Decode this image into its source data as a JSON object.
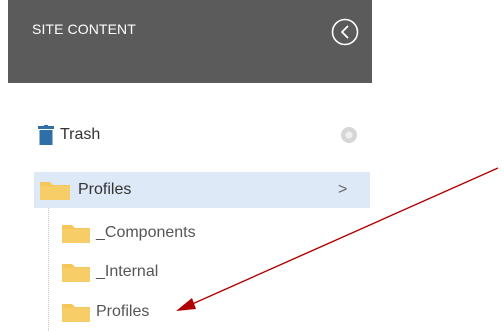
{
  "sidebar": {
    "title": "SITE CONTENT",
    "collapse_icon": "chevron-left-circle-icon"
  },
  "tree": {
    "trash": {
      "label": "Trash",
      "icon": "trash-icon"
    },
    "selected_folder": {
      "label": "Profiles",
      "icon": "folder-icon",
      "chevron": ">"
    },
    "children": [
      {
        "label": "_Components",
        "icon": "folder-icon"
      },
      {
        "label": "_Internal",
        "icon": "folder-icon"
      },
      {
        "label": "Profiles",
        "icon": "folder-icon"
      }
    ]
  },
  "colors": {
    "header_bg": "#5b5b5b",
    "selected_bg": "#dde9f6",
    "folder": "#f5c65a",
    "trash": "#2f6fa8",
    "arrow": "#b00000"
  }
}
